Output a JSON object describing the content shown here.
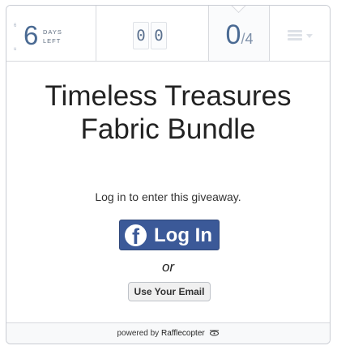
{
  "countdown": {
    "value": "6",
    "label_line1": "DAYS",
    "label_line2": "LEFT",
    "top_mark": "6",
    "bottom_mark": "u"
  },
  "entries": {
    "digits": [
      "0",
      "0"
    ]
  },
  "points": {
    "earned": "0",
    "separator": "/",
    "total": "4"
  },
  "menu": {
    "icon": "hamburger-icon"
  },
  "prize": {
    "title_line1": "Timeless Treasures",
    "title_line2": "Fabric Bundle"
  },
  "login": {
    "prompt": "Log in to enter this giveaway.",
    "facebook_label": "Log In",
    "facebook_icon": "facebook-logo-icon",
    "or_text": "or",
    "email_label": "Use Your Email"
  },
  "footer": {
    "powered_by": "powered by",
    "brand": "Rafflecopter",
    "icon": "rafflecopter-logo-icon"
  },
  "colors": {
    "facebook_blue": "#3b5998",
    "counter_blue": "#4a6a93",
    "border": "#c9ccd3"
  }
}
